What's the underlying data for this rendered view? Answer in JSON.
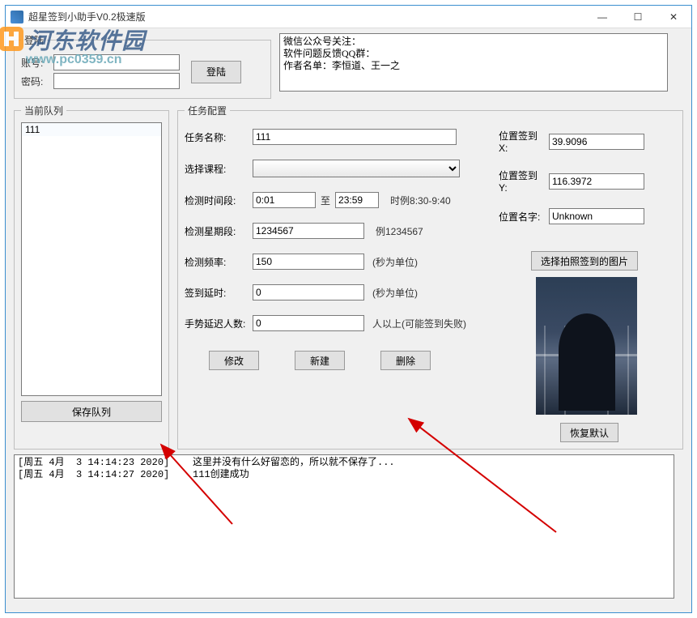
{
  "window": {
    "title": "超星签到小助手V0.2极速版"
  },
  "login": {
    "legend": "登陆",
    "account_label": "账号:",
    "password_label": "密码:",
    "account_value": "",
    "password_value": "",
    "login_btn": "登陆"
  },
  "info_box": "微信公众号关注：\n软件问题反馈QQ群：\n作者名单：李恒道、王一之",
  "queue": {
    "legend": "当前队列",
    "items": [
      "111"
    ],
    "save_btn": "保存队列"
  },
  "task": {
    "legend": "任务配置",
    "name_label": "任务名称:",
    "name_value": "111",
    "course_label": "选择课程:",
    "course_value": "",
    "time_label": "检测时间段:",
    "time_from": "0:01",
    "time_to_label": "至",
    "time_to": "23:59",
    "time_hint": "时例8:30-9:40",
    "week_label": "检测星期段:",
    "week_value": "1234567",
    "week_hint": "例1234567",
    "freq_label": "检测频率:",
    "freq_value": "150",
    "freq_hint": "(秒为单位)",
    "delay_label": "签到延时:",
    "delay_value": "0",
    "delay_hint": "(秒为单位)",
    "gesture_label": "手势延迟人数:",
    "gesture_value": "0",
    "gesture_hint": "人以上(可能签到失败)",
    "modify_btn": "修改",
    "new_btn": "新建",
    "delete_btn": "删除",
    "pos_x_label": "位置签到X:",
    "pos_x_value": "39.9096",
    "pos_y_label": "位置签到Y:",
    "pos_y_value": "116.3972",
    "pos_name_label": "位置名字:",
    "pos_name_value": "Unknown",
    "choose_img_btn": "选择拍照签到的图片",
    "restore_btn": "恢复默认"
  },
  "log": "[周五 4月  3 14:14:23 2020]    这里并没有什么好留恋的，所以就不保存了...\n[周五 4月  3 14:14:27 2020]    111创建成功",
  "watermark": {
    "brand": "河东软件园",
    "url": "www.pc0359.cn"
  }
}
